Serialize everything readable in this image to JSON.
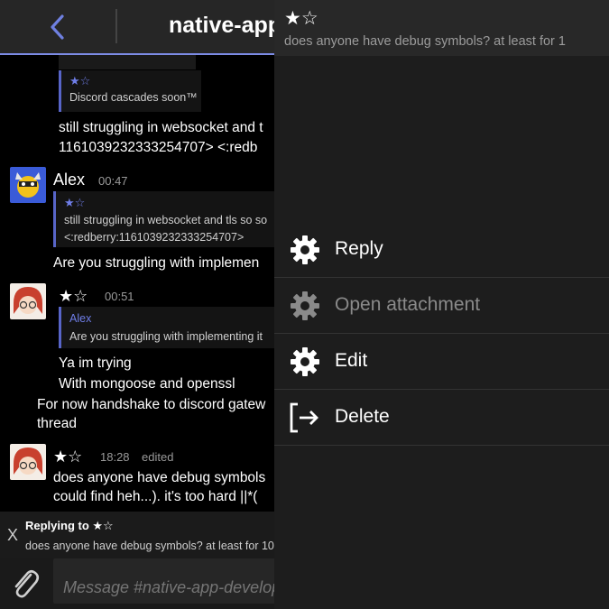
{
  "header": {
    "title": "native-app",
    "back_icon": "chevron-left-icon",
    "accent": "#7d8ce6"
  },
  "messages": [
    {
      "quote_star": "★☆",
      "quote_text": "Discord cascades soon™",
      "body_lines": [
        "still struggling in websocket and t",
        "1161039232333254707> <:redb"
      ]
    },
    {
      "author": "Alex",
      "time": "00:47",
      "quote_star": "★☆",
      "quote_lines": [
        "still struggling in websocket and tls so so",
        "<:redberry:1161039232333254707>"
      ],
      "body_lines": [
        "Are you struggling with implemen"
      ]
    },
    {
      "author": "★☆",
      "time": "00:51",
      "quote_author": "Alex",
      "quote_text": "Are you struggling with implementing it",
      "body_lines": [
        "Ya im trying",
        "With mongoose and openssl"
      ],
      "extra_lines": [
        "For now handshake to discord gatew",
        "thread"
      ]
    },
    {
      "author": "★☆",
      "time": "18:28",
      "edited": "edited",
      "body_lines": [
        "does anyone have debug symbols",
        "could find heh...). it's too hard ||*("
      ]
    }
  ],
  "reply_bar": {
    "title": "Replying to ★☆",
    "text": "does anyone have debug symbols? at least for 10",
    "close": "X"
  },
  "composer": {
    "placeholder": "Message #native-app-develop",
    "attach_icon": "paperclip-icon"
  },
  "context_panel": {
    "stars": "★☆",
    "preview": "does anyone have debug symbols? at least for 1",
    "items": [
      {
        "label": "Reply",
        "icon": "gear-icon",
        "enabled": true
      },
      {
        "label": "Open attachment",
        "icon": "gear-icon",
        "enabled": false
      },
      {
        "label": "Edit",
        "icon": "gear-icon",
        "enabled": true
      },
      {
        "label": "Delete",
        "icon": "exit-icon",
        "enabled": true
      }
    ]
  }
}
